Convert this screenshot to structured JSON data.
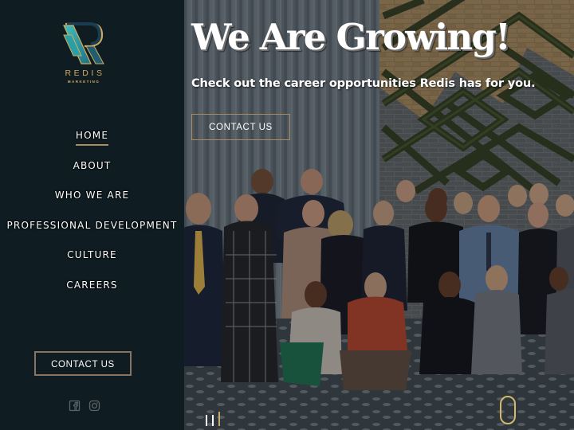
{
  "brand": {
    "name": "REDIS",
    "tagline": "MARKETING",
    "logo_icon": "redis-r-monogram",
    "colors": {
      "gold": "#d1ac5e",
      "teal": "#2aa7a8",
      "sidebar_bg": "#0f1c22",
      "accent_border": "#a88b60"
    }
  },
  "nav": {
    "items": [
      {
        "label": "HOME",
        "active": true
      },
      {
        "label": "ABOUT",
        "active": false
      },
      {
        "label": "WHO WE ARE",
        "active": false
      },
      {
        "label": "PROFESSIONAL DEVELOPMENT",
        "active": false
      },
      {
        "label": "CULTURE",
        "active": false
      },
      {
        "label": "CAREERS",
        "active": false
      }
    ]
  },
  "sidebar": {
    "contact_label": "CONTACT US",
    "social": [
      {
        "name": "facebook",
        "icon": "facebook-icon"
      },
      {
        "name": "instagram",
        "icon": "instagram-icon"
      }
    ]
  },
  "hero": {
    "title": "We Are Growing!",
    "subtitle": "Check out the career opportunities Redis has for you.",
    "contact_label": "CONTACT US",
    "background_image": "team-group-photo",
    "slides": {
      "count": 3,
      "active_index": 2
    }
  }
}
